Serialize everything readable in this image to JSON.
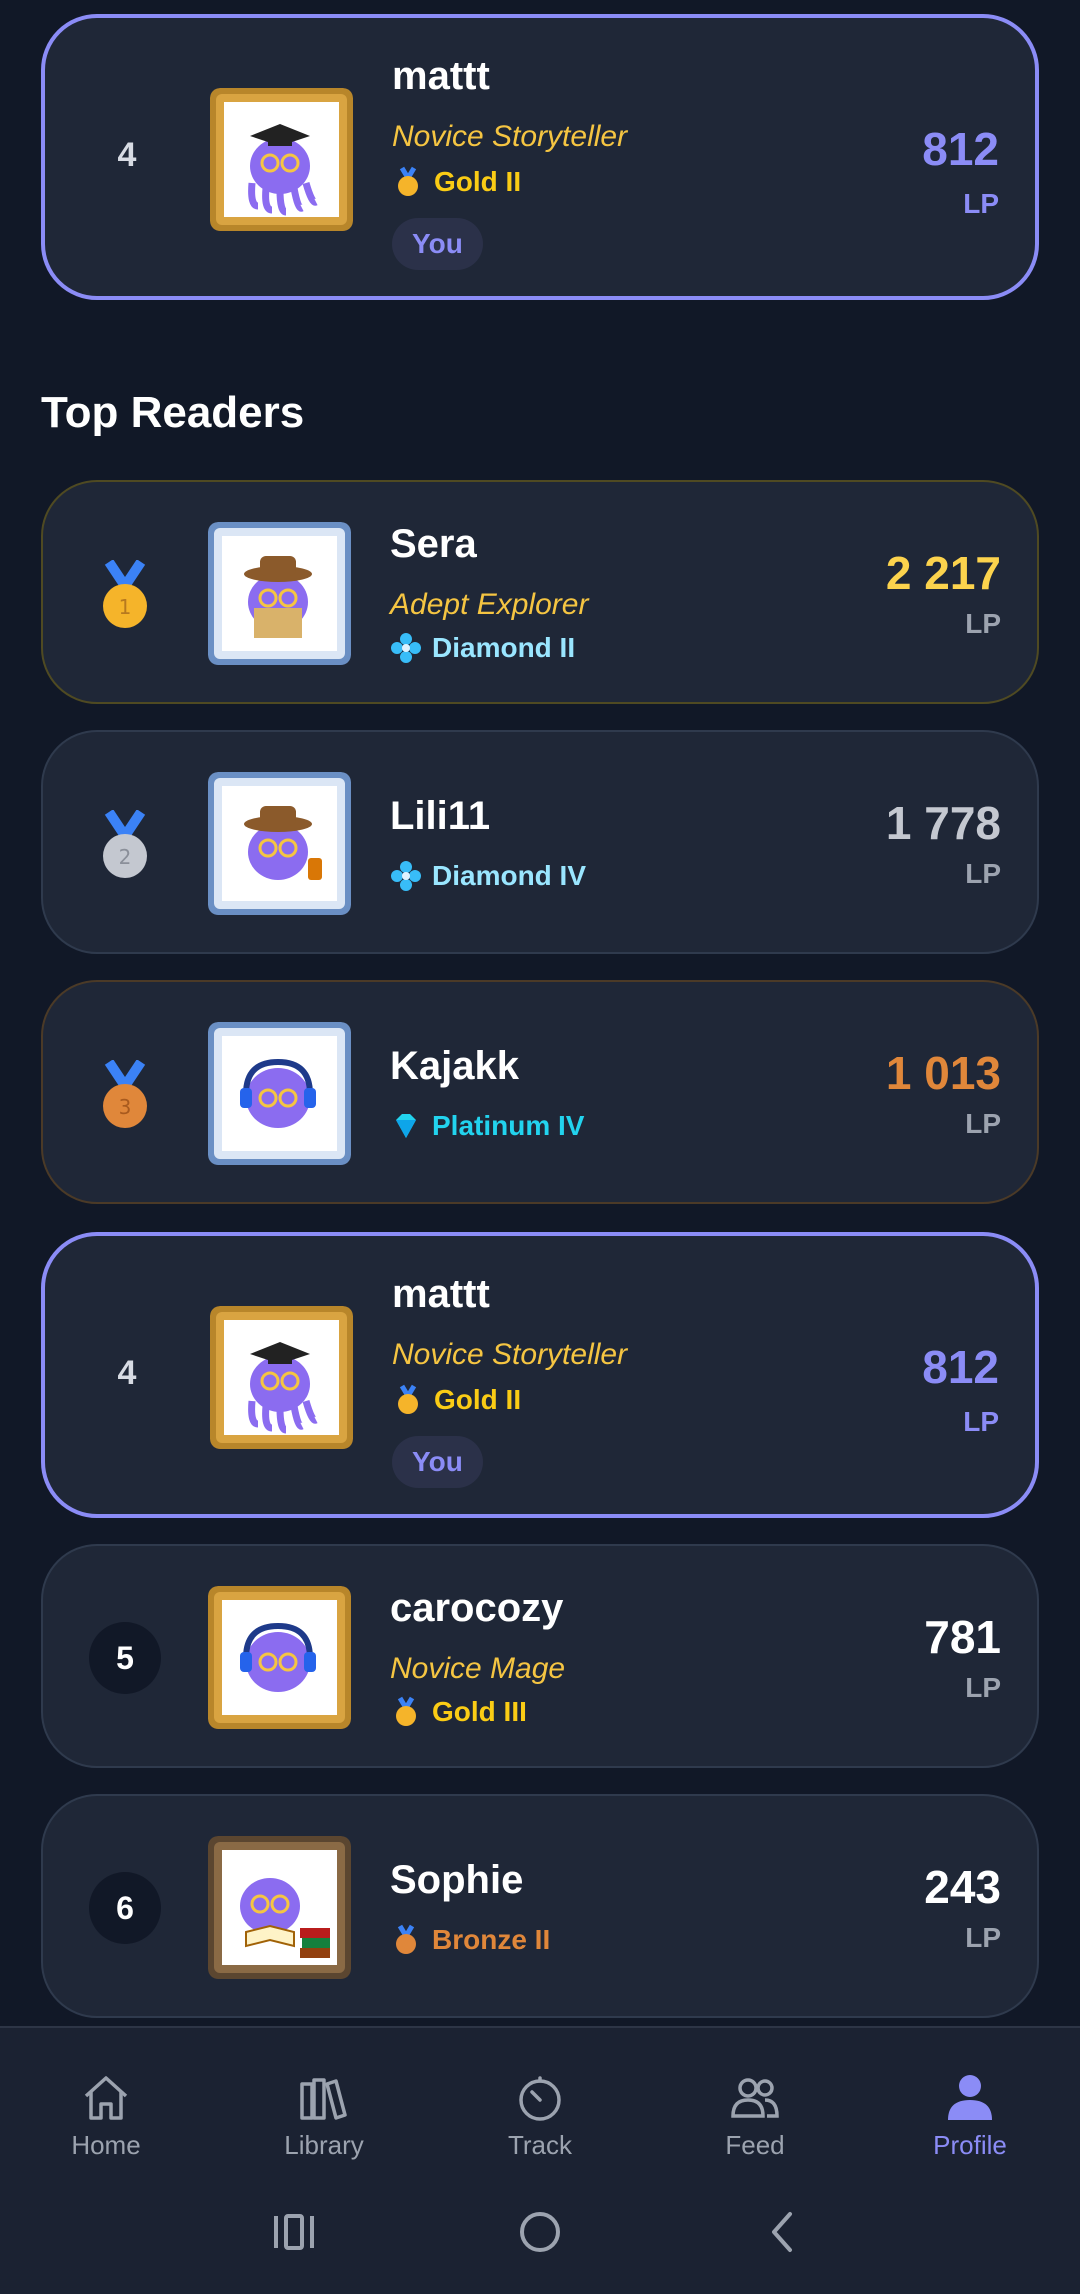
{
  "pinned_card": {
    "rank": "4",
    "name": "mattt",
    "title": "Novice Storyteller",
    "tier": "Gold II",
    "you_label": "You",
    "score": "812",
    "lp_label": "LP"
  },
  "section_title": "Top Readers",
  "readers": [
    {
      "rank": "1",
      "medal": "gold",
      "name": "Sera",
      "title": "Adept Explorer",
      "tier": "Diamond II",
      "tier_color": "#9ae6ff",
      "score": "2 217",
      "score_color": "#fcd34d",
      "lp_label": "LP",
      "avatar": "explorer-octopus",
      "frame": "silver"
    },
    {
      "rank": "2",
      "medal": "silver",
      "name": "Lili11",
      "title": "",
      "tier": "Diamond IV",
      "tier_color": "#9ae6ff",
      "score": "1 778",
      "score_color": "#c4c8d0",
      "lp_label": "LP",
      "avatar": "lantern-octopus",
      "frame": "silver"
    },
    {
      "rank": "3",
      "medal": "bronze",
      "name": "Kajakk",
      "title": "",
      "tier": "Platinum IV",
      "tier_color": "#22d3ee",
      "score": "1 013",
      "score_color": "#e0873a",
      "lp_label": "LP",
      "avatar": "music-octopus",
      "frame": "silver"
    },
    {
      "rank": "4",
      "medal": "",
      "name": "mattt",
      "title": "Novice Storyteller",
      "tier": "Gold II",
      "tier_color": "#facc15",
      "score": "812",
      "score_color": "#8b8cf6",
      "lp_label": "LP",
      "you_label": "You",
      "avatar": "graduate-octopus",
      "frame": "gold"
    },
    {
      "rank": "5",
      "medal": "",
      "name": "carocozy",
      "title": "Novice Mage",
      "tier": "Gold III",
      "tier_color": "#facc15",
      "score": "781",
      "score_color": "#ffffff",
      "lp_label": "LP",
      "avatar": "music-octopus",
      "frame": "gold"
    },
    {
      "rank": "6",
      "medal": "",
      "name": "Sophie",
      "title": "",
      "tier": "Bronze II",
      "tier_color": "#e0873a",
      "score": "243",
      "score_color": "#ffffff",
      "lp_label": "LP",
      "avatar": "reading-octopus",
      "frame": "bronze"
    }
  ],
  "nav": {
    "items": [
      {
        "label": "Home",
        "icon": "home-icon"
      },
      {
        "label": "Library",
        "icon": "library-icon"
      },
      {
        "label": "Track",
        "icon": "timer-icon"
      },
      {
        "label": "Feed",
        "icon": "people-icon"
      },
      {
        "label": "Profile",
        "icon": "person-icon"
      }
    ],
    "active": "Profile",
    "active_color": "#8b8cf6"
  },
  "colors": {
    "background": "#111827",
    "card": "#1f2737",
    "accent": "#8b8cf6",
    "title_gold": "#f5c542"
  }
}
